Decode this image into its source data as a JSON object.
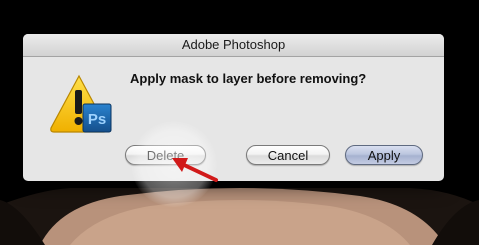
{
  "dialog": {
    "title": "Adobe Photoshop",
    "message": "Apply mask to layer before removing?",
    "icon_name": "warning-photoshop-icon",
    "buttons": {
      "delete": "Delete",
      "cancel": "Cancel",
      "apply": "Apply"
    }
  },
  "colors": {
    "dialog_bg": "#e6e6e6",
    "warning_yellow": "#f4c400",
    "ps_blue": "#1f6fb5",
    "arrow_red": "#d11a1a",
    "default_button": "#a6b2d0"
  },
  "overlay": {
    "arrow_icon": "red-arrow-pointer-icon",
    "highlight": "click-highlight"
  }
}
